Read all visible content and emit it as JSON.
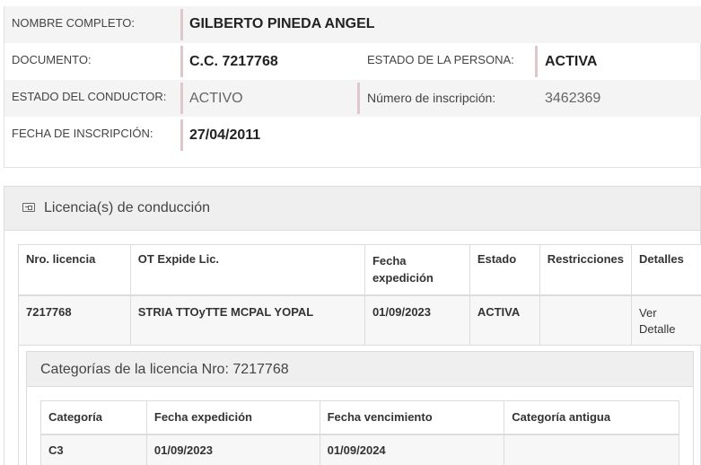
{
  "person": {
    "nombre_label": "NOMBRE COMPLETO:",
    "nombre_value": "GILBERTO PINEDA ANGEL",
    "documento_label": "DOCUMENTO:",
    "documento_value": "C.C. 7217768",
    "estado_persona_label": "ESTADO DE LA PERSONA:",
    "estado_persona_value": "ACTIVA",
    "estado_conductor_label": "ESTADO DEL CONDUCTOR:",
    "estado_conductor_value": "ACTIVO",
    "inscripcion_num_label": "Número de inscripción:",
    "inscripcion_num_value": "3462369",
    "fecha_inscripcion_label": "FECHA DE INSCRIPCIÓN:",
    "fecha_inscripcion_value": "27/04/2011"
  },
  "licencias": {
    "section_title": "Licencia(s) de conducción",
    "icon": "id-card-icon",
    "columns": [
      "Nro. licencia",
      "OT Expide Lic.",
      "Fecha expedición",
      "Estado",
      "Restricciones",
      "Detalles"
    ],
    "rows": [
      {
        "nro": "7217768",
        "ot": "STRIA TTOyTTE MCPAL YOPAL",
        "fecha": "01/09/2023",
        "estado": "ACTIVA",
        "restricciones": "",
        "detalles": "Ver Detalle"
      }
    ]
  },
  "categorias": {
    "title": "Categorías de la licencia Nro: 7217768",
    "columns": [
      "Categoría",
      "Fecha expedición",
      "Fecha vencimiento",
      "Categoría antigua"
    ],
    "rows": [
      {
        "categoria": "C3",
        "fecha_exp": "01/09/2023",
        "fecha_ven": "01/09/2024",
        "antigua": ""
      }
    ]
  }
}
